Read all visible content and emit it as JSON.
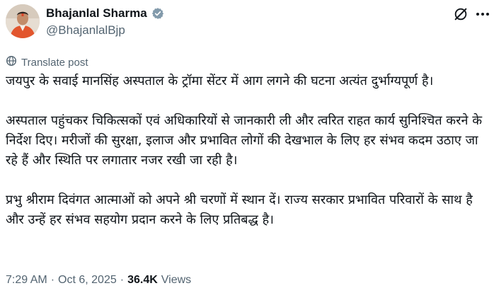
{
  "author": {
    "display_name": "Bhajanlal Sharma",
    "handle": "@BhajanlalBjp",
    "verified_icon": "verified-badge-icon",
    "verified_color": "#829aab"
  },
  "translate": {
    "icon": "globe-icon",
    "label": "Translate post"
  },
  "post": {
    "paragraphs": [
      "जयपुर के सवाई मानसिंह अस्पताल के ट्रॉमा सेंटर में आग लगने की घटना अत्यंत दुर्भाग्यपूर्ण है।",
      "अस्पताल पहुंचकर चिकित्सकों एवं अधिकारियों से जानकारी ली और त्वरित राहत कार्य सुनिश्चित करने के निर्देश दिए। मरीजों की सुरक्षा, इलाज और प्रभावित लोगों की देखभाल के लिए हर संभव कदम उठाए जा रहे हैं और स्थिति पर लगातार नजर रखी जा रही है।",
      "प्रभु श्रीराम दिवंगत आत्माओं को अपने श्री चरणों में स्थान दें। राज्य सरकार प्रभावित परिवारों के साथ है और उन्हें हर संभव सहयोग प्रदान करने के लिए प्रतिबद्ध है।"
    ]
  },
  "meta": {
    "time": "7:29 AM",
    "separator": "·",
    "date": "Oct 6, 2025",
    "views_count": "36.4K",
    "views_label": "Views"
  },
  "actions": {
    "grok_icon": "grok-icon",
    "more_icon": "more-dots-icon"
  }
}
